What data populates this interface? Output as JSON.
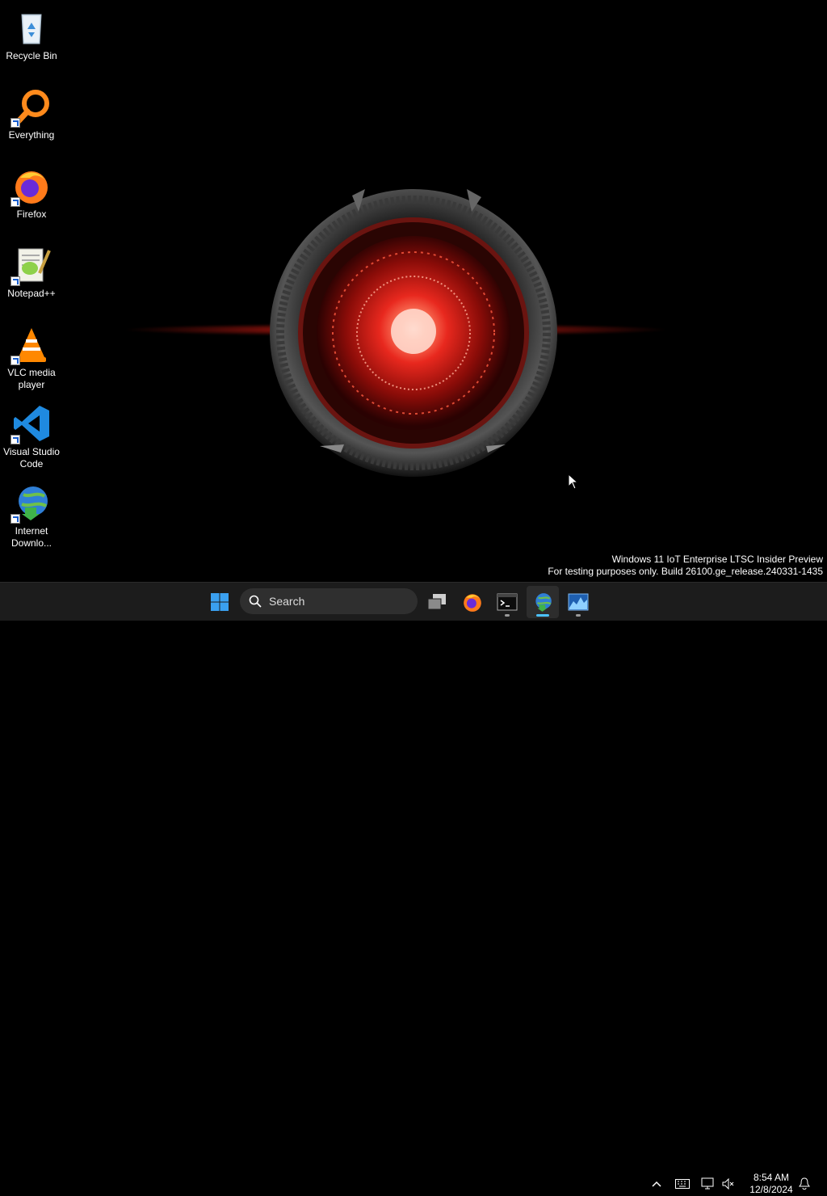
{
  "desktop": {
    "icons": [
      {
        "label": "Recycle Bin",
        "icon": "recycle-bin-icon"
      },
      {
        "label": "Everything",
        "icon": "everything-search-icon"
      },
      {
        "label": "Firefox",
        "icon": "firefox-icon"
      },
      {
        "label": "Notepad++",
        "icon": "notepad-plus-plus-icon"
      },
      {
        "label": "VLC media player",
        "icon": "vlc-icon"
      },
      {
        "label": "Visual Studio Code",
        "icon": "vscode-icon"
      },
      {
        "label": "Internet Downlo...",
        "icon": "internet-download-manager-icon"
      }
    ],
    "watermark": {
      "line1": "Windows 11 IoT Enterprise LTSC Insider Preview",
      "line2": "For testing purposes only. Build 26100.ge_release.240331-1435"
    }
  },
  "taskbar": {
    "search_placeholder": "Search",
    "apps": [
      {
        "name": "start",
        "icon": "windows-start-icon"
      },
      {
        "name": "task-view",
        "icon": "task-view-icon"
      },
      {
        "name": "firefox",
        "icon": "firefox-icon"
      },
      {
        "name": "terminal",
        "icon": "terminal-icon"
      },
      {
        "name": "internet-download-manager",
        "icon": "internet-download-manager-icon"
      },
      {
        "name": "system-monitor",
        "icon": "chart-window-icon"
      }
    ],
    "clock": {
      "time": "8:54 AM",
      "date": "12/8/2024"
    }
  },
  "colors": {
    "taskbar_bg": "#1c1c1c",
    "accent": "#4cc2ff",
    "wallpaper_glow": "#e8281e"
  }
}
